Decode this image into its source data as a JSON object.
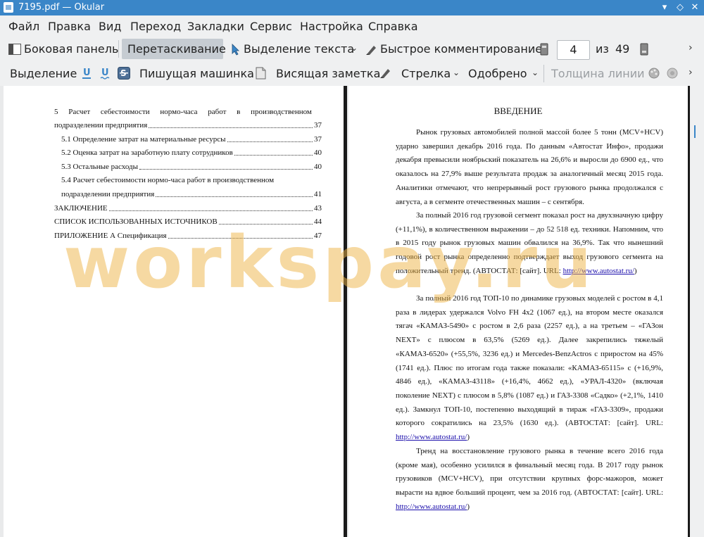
{
  "window": {
    "title": "7195.pdf  — Okular"
  },
  "menu": [
    "Файл",
    "Правка",
    "Вид",
    "Переход",
    "Закладки",
    "Сервис",
    "Настройка",
    "Справка"
  ],
  "toolbar1": {
    "sidebar": "Боковая панель",
    "drag": "Перетаскивание",
    "text_select": "Выделение текста",
    "quick_comment": "Быстрое комментирование",
    "page_current": "4",
    "page_of": "из",
    "page_total": "49"
  },
  "toolbar2": {
    "select": "Выделение",
    "typewriter": "Пишущая машинка",
    "sticky_note": "Висящая заметка",
    "arrow": "Стрелка",
    "stamp": "Одобрено",
    "line_width": "Толщина линии"
  },
  "left_page": {
    "toc": [
      {
        "title": "5 Расчет себестоимости нормо-часа работ в производственном",
        "page": ""
      },
      {
        "title": "подразделении предприятия",
        "page": "37"
      },
      {
        "title": "5.1 Определение затрат на материальные ресурсы",
        "page": "37"
      },
      {
        "title": "5.2 Оценка затрат на заработную плату сотрудников",
        "page": "40"
      },
      {
        "title": "5.3 Остальные расходы",
        "page": "40"
      },
      {
        "title": "5.4 Расчет себестоимости нормо-часа работ в производственном",
        "page": ""
      },
      {
        "title": "подразделении предприятия",
        "page": "41"
      },
      {
        "title": "ЗАКЛЮЧЕНИЕ",
        "page": "43"
      },
      {
        "title": "СПИСОК ИСПОЛЬЗОВАННЫХ ИСТОЧНИКОВ",
        "page": "44"
      },
      {
        "title": "ПРИЛОЖЕНИЕ А Спецификация",
        "page": "47"
      }
    ]
  },
  "right_page": {
    "heading": "ВВЕДЕНИЕ",
    "p1": "Рынок грузовых автомобилей полной массой более 5 тонн (MCV+HCV) ударно завершил декабрь 2016 года. По данным «Автостат Инфо», продажи декабря превысили ноябрьский показатель на 26,6% и выросли до 6900 ед., что оказалось на 27,9% выше результата продаж за аналогичный месяц 2015 года. Аналитики отмечают, что непрерывный рост грузового рынка продолжался с августа, а в сегменте отечественных машин – с сентября.",
    "p2": "За полный 2016 год грузовой сегмент показал рост на двухзначную цифру (+11,1%), в количественном выражении – до 52 518 ед. техники. Напомним, что в 2015 году рынок грузовых машин обвалился на 36,9%. Так что нынешний годовой рост рынка определенно подтверждает выход грузового сегмента на положительный тренд. (АВТОСТАТ: [сайт]. URL: ",
    "p2_link": "http://www.autostat.ru/",
    "p2_end": ")",
    "p3": "За полный 2016 год ТОП-10 по динамике грузовых моделей с ростом в 4,1 раза в лидерах удержался Volvo FH 4x2 (1067 ед.), на втором месте оказался тягач «КАМАЗ-5490» с ростом в 2,6 раза (2257 ед.), а на третьем – «ГАЗон NEXT» с плюсом в 63,5% (5269 ед.). Далее закрепились тяжелый «КАМАЗ-6520» (+55,5%, 3236 ед.) и Mercedes-BenzActros с приростом на 45% (1741 ед.). Плюс по итогам года также показали: «КАМАЗ-65115» с (+16,9%, 4846 ед.), «КАМАЗ-43118» (+16,4%, 4662 ед.), «УРАЛ-4320» (включая поколение NEXT) с плюсом в 5,8% (1087 ед.) и ГАЗ-3308 «Садко» (+2,1%, 1410 ед.). Замкнул ТОП-10, постепенно выходящий в тираж «ГАЗ-3309», продажи которого сократились на 23,5% (1630 ед.). (АВТОСТАТ: [сайт]. URL: ",
    "p3_link": "http://www.autostat.ru/",
    "p3_end": ")",
    "p4": "Тренд на восстановление грузового рынка в течение всего 2016 года (кроме мая), особенно усилился в финальный месяц года. В 2017 году рынок грузовиков (MCV+HCV), при отсутствии крупных форс-мажоров, может вырасти на вдвое больший процент, чем за 2016 год. (АВТОСТАТ: [сайт]. URL: ",
    "p4_link": "http://www.autostat.ru/",
    "p4_end": ")"
  },
  "watermark": "workspay.ru"
}
